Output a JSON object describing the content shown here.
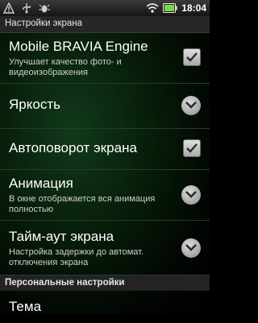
{
  "status_bar": {
    "time": "18:04",
    "left_icons": [
      "alert-icon",
      "usb-icon",
      "usb-debug-icon"
    ],
    "right_icons": [
      "wifi-icon",
      "battery-icon"
    ]
  },
  "screen": {
    "title": "Настройки экрана"
  },
  "settings": [
    {
      "title": "Mobile BRAVIA Engine",
      "summary": "Улучшает качество фото- и видеоизображения",
      "control": "checkbox",
      "checked": true
    },
    {
      "title": "Яркость",
      "summary": "",
      "control": "chevron"
    },
    {
      "title": "Автоповорот экрана",
      "summary": "",
      "control": "checkbox",
      "checked": true
    },
    {
      "title": "Анимация",
      "summary": "В окне отображается вся анимация полностью",
      "control": "chevron"
    },
    {
      "title": "Тайм-аут экрана",
      "summary": "Настройка задержки до автомат. отключения экрана",
      "control": "chevron"
    }
  ],
  "section": {
    "title": "Персональные настройки"
  },
  "next_item": {
    "title": "Тема"
  },
  "colors": {
    "checkbox": "#c9c9c9",
    "background": "#041006",
    "section": "#232323"
  }
}
